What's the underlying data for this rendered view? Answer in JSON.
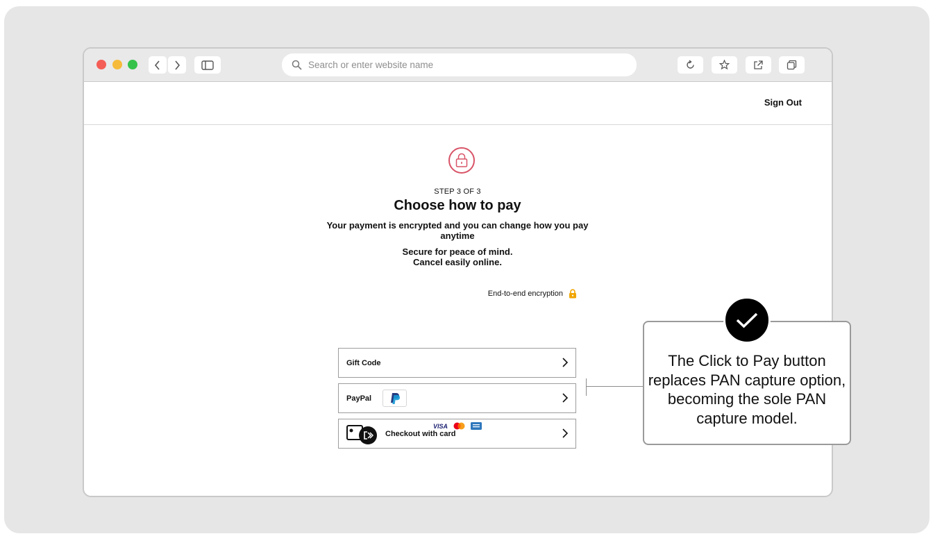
{
  "browser": {
    "search_placeholder": "Search or enter website name"
  },
  "header": {
    "sign_out_label": "Sign Out"
  },
  "checkout": {
    "step_label": "STEP 3 OF 3",
    "title": "Choose how to pay",
    "subtitle": "Your payment is encrypted and you can change how you pay anytime",
    "secure_line1": "Secure for peace of mind.",
    "secure_line2": "Cancel easily online.",
    "encryption_label": "End-to-end encryption",
    "options": [
      {
        "label": "Gift Code"
      },
      {
        "label": "PayPal"
      },
      {
        "label": "Checkout with card"
      }
    ],
    "card_brands": {
      "visa": "VISA"
    },
    "accent_color": "#d85367",
    "lock_color": "#f0a500"
  },
  "callout": {
    "text": "The Click to Pay button replaces PAN capture option, becoming the sole PAN capture model."
  }
}
